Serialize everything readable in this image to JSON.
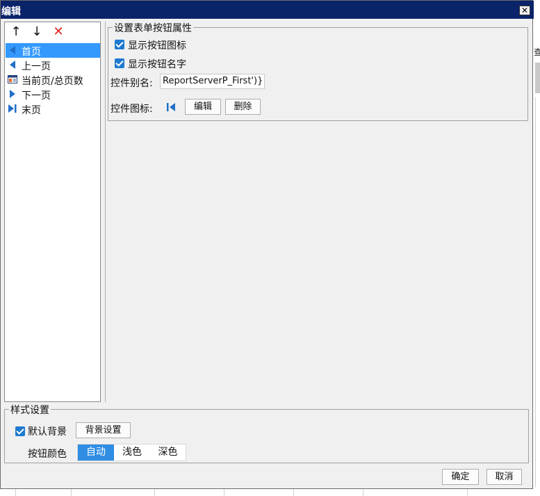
{
  "dialog": {
    "title": "编辑",
    "close_glyph": "✕"
  },
  "toolbar": {
    "up_icon": "↑",
    "down_icon": "↓",
    "delete_icon": "✕",
    "delete_color": "#e02020"
  },
  "tree": {
    "items": [
      {
        "label": "首页",
        "icon": "first-page-icon",
        "selected": true
      },
      {
        "label": "上一页",
        "icon": "previous-page-icon",
        "selected": false
      },
      {
        "label": "当前页/总页数",
        "icon": "page-count-icon",
        "selected": false
      },
      {
        "label": "下一页",
        "icon": "next-page-icon",
        "selected": false
      },
      {
        "label": "末页",
        "icon": "last-page-icon",
        "selected": false
      }
    ]
  },
  "props": {
    "legend": "设置表单按钮属性",
    "show_icon_label": "显示按钮图标",
    "show_icon_checked": true,
    "show_name_label": "显示按钮名字",
    "show_name_checked": true,
    "alias_label": "控件别名:",
    "alias_value": "ReportServerP_First')}",
    "icon_label": "控件图标:",
    "edit_button": "编辑",
    "delete_button": "删除"
  },
  "style": {
    "legend": "样式设置",
    "default_bg_label": "默认背景",
    "default_bg_checked": true,
    "bg_settings_button": "背景设置",
    "button_color_label": "按钮颜色",
    "color_options": [
      "自动",
      "浅色",
      "深色"
    ],
    "selected_color": "自动"
  },
  "footer": {
    "ok_button": "确定",
    "cancel_button": "取消"
  },
  "background": {
    "peek_char": "查"
  },
  "colors": {
    "titlebar": "#0a246a",
    "selection": "#3399ff",
    "checkbox": "#1e7ad1",
    "segment_active": "#2f8de4",
    "nav_icon": "#1f6fc8"
  }
}
